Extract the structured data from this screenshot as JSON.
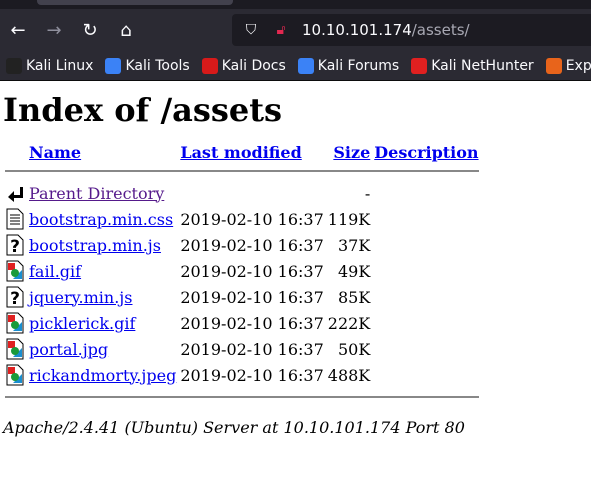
{
  "browser": {
    "url_host": "10.10.101.174",
    "url_path": "/assets/",
    "bookmarks": [
      {
        "label": "Kali Linux",
        "color": "#222"
      },
      {
        "label": "Kali Tools",
        "color": "#3b82f6"
      },
      {
        "label": "Kali Docs",
        "color": "#d71a1a"
      },
      {
        "label": "Kali Forums",
        "color": "#3b82f6"
      },
      {
        "label": "Kali NetHunter",
        "color": "#e02020"
      },
      {
        "label": "Exploit",
        "color": "#e8641b"
      }
    ]
  },
  "page": {
    "title": "Index of /assets",
    "headers": {
      "name": "Name",
      "modified": "Last modified",
      "size": "Size",
      "description": "Description"
    },
    "rows": [
      {
        "icon": "back",
        "name": "Parent Directory",
        "modified": "",
        "size": "-",
        "visited": true
      },
      {
        "icon": "text",
        "name": "bootstrap.min.css",
        "modified": "2019-02-10 16:37",
        "size": "119K"
      },
      {
        "icon": "unknown",
        "name": "bootstrap.min.js",
        "modified": "2019-02-10 16:37",
        "size": "37K"
      },
      {
        "icon": "image",
        "name": "fail.gif",
        "modified": "2019-02-10 16:37",
        "size": "49K"
      },
      {
        "icon": "unknown",
        "name": "jquery.min.js",
        "modified": "2019-02-10 16:37",
        "size": "85K"
      },
      {
        "icon": "image",
        "name": "picklerick.gif",
        "modified": "2019-02-10 16:37",
        "size": "222K"
      },
      {
        "icon": "image",
        "name": "portal.jpg",
        "modified": "2019-02-10 16:37",
        "size": "50K"
      },
      {
        "icon": "image",
        "name": "rickandmorty.jpeg",
        "modified": "2019-02-10 16:37",
        "size": "488K"
      }
    ],
    "footer": "Apache/2.4.41 (Ubuntu) Server at 10.10.101.174 Port 80"
  }
}
